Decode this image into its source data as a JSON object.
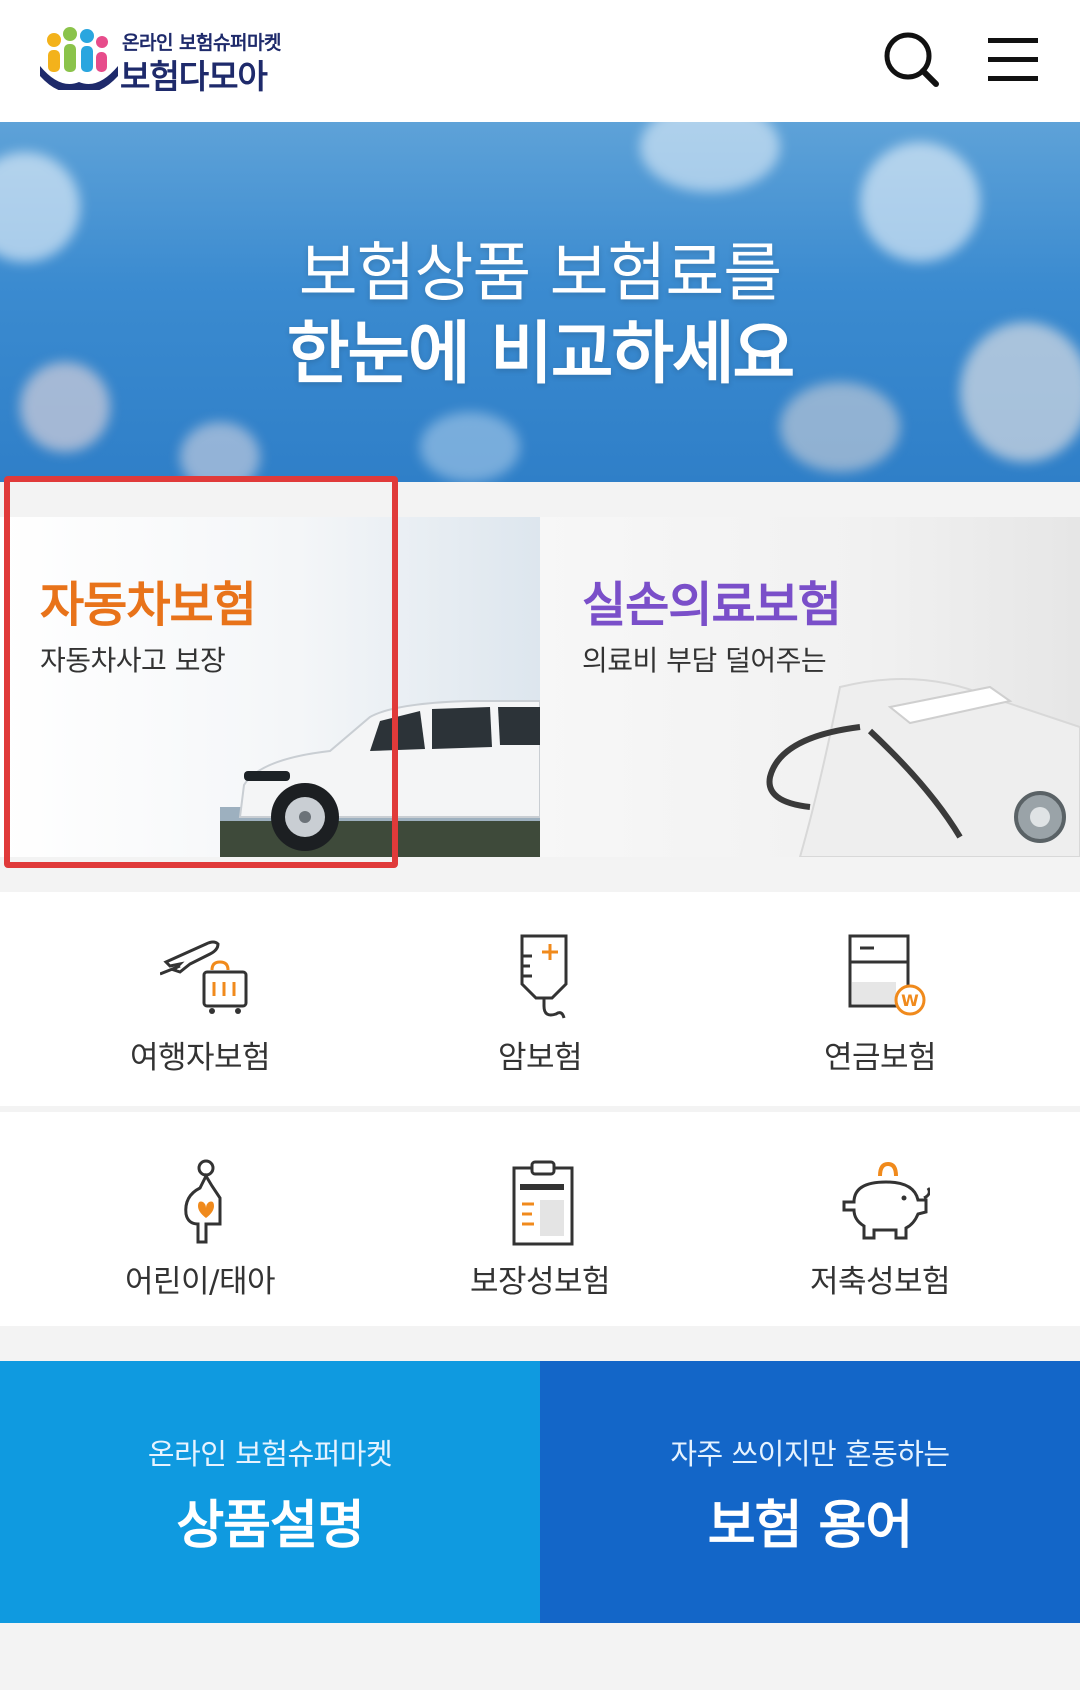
{
  "header": {
    "logo_sub": "온라인 보험슈퍼마켓",
    "logo_main": "보험다모아",
    "icons": [
      "search-icon",
      "hamburger-menu-icon"
    ]
  },
  "hero": {
    "line1": "보험상품 보험료를",
    "line2": "한눈에 비교하세요"
  },
  "cards": [
    {
      "title": "자동차보험",
      "desc": "자동차사고 보장",
      "title_color": "#e8731a",
      "highlighted": true,
      "icon": "car-image"
    },
    {
      "title": "실손의료보험",
      "desc": "의료비 부담 덜어주는",
      "title_color": "#7a4fc9",
      "highlighted": false,
      "icon": "stethoscope-image"
    }
  ],
  "grid": [
    {
      "label": "여행자보험",
      "icon": "travel-airplane-luggage-icon"
    },
    {
      "label": "암보험",
      "icon": "iv-drip-icon"
    },
    {
      "label": "연금보험",
      "icon": "pension-document-won-icon"
    },
    {
      "label": "어린이/태아",
      "icon": "pregnant-woman-heart-icon"
    },
    {
      "label": "보장성보험",
      "icon": "clipboard-icon"
    },
    {
      "label": "저축성보험",
      "icon": "piggy-bank-icon"
    }
  ],
  "banners": [
    {
      "sub": "온라인 보험슈퍼마켓",
      "title": "상품설명",
      "bg": "#0f9ae0"
    },
    {
      "sub": "자주 쓰이지만 혼동하는",
      "title": "보험 용어",
      "bg": "#1366c8"
    }
  ],
  "colors": {
    "accent_orange": "#f08a1c",
    "highlight_red": "#e03a3a",
    "navy": "#1e2a6b"
  }
}
